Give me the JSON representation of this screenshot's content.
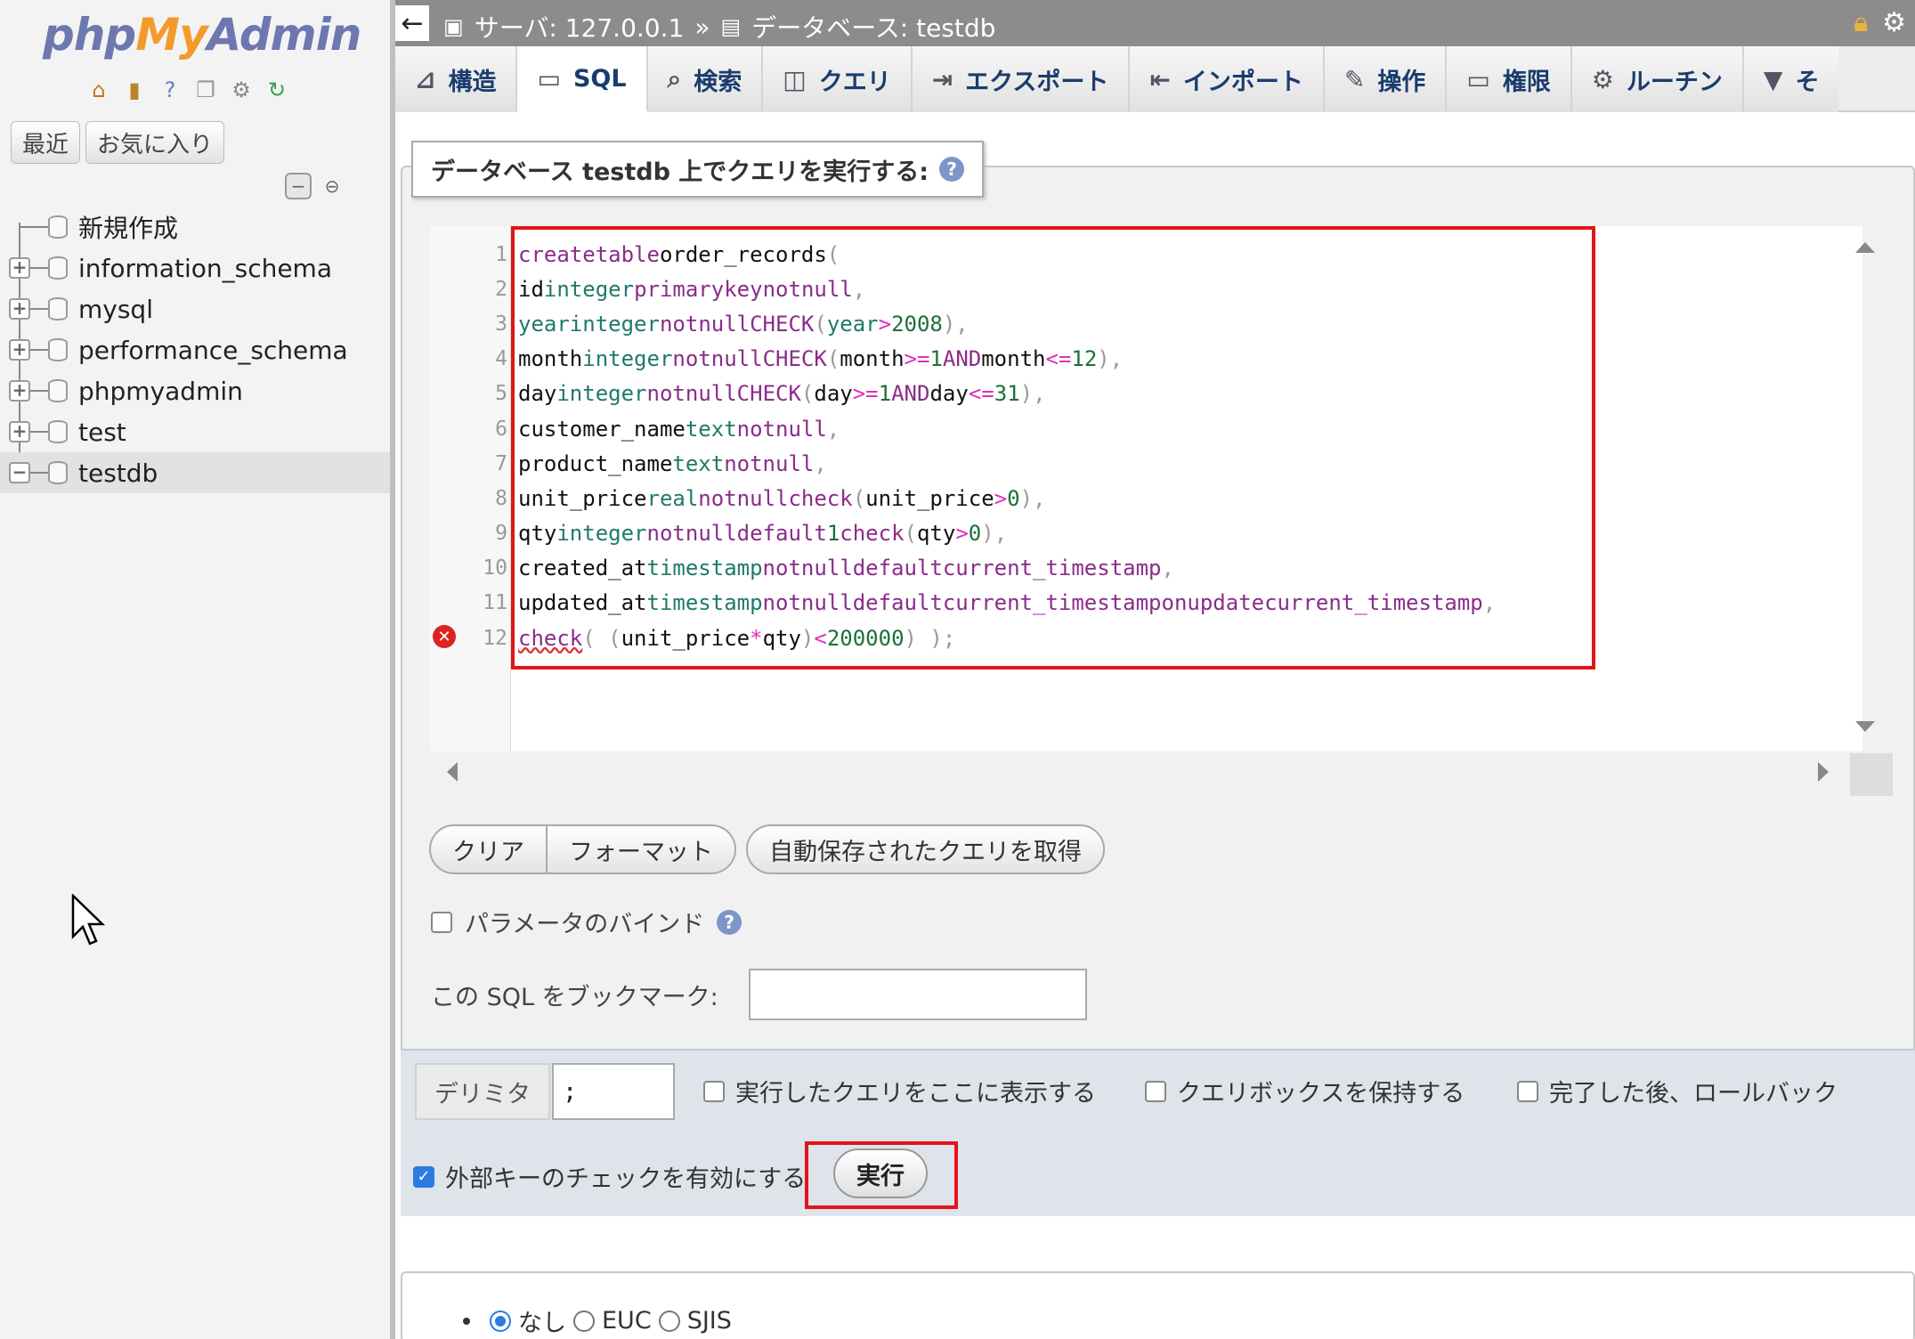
{
  "brand": {
    "part1": "php",
    "part2": "My",
    "part3": "Admin"
  },
  "nav": {
    "recent": "最近",
    "favorites": "お気に入り",
    "tree": [
      {
        "label": "新規作成",
        "expander": ""
      },
      {
        "label": "information_schema",
        "expander": "+"
      },
      {
        "label": "mysql",
        "expander": "+"
      },
      {
        "label": "performance_schema",
        "expander": "+"
      },
      {
        "label": "phpmyadmin",
        "expander": "+"
      },
      {
        "label": "test",
        "expander": "+"
      },
      {
        "label": "testdb",
        "expander": "−"
      }
    ]
  },
  "topbar": {
    "server": "サーバ: 127.0.0.1",
    "sep": "»",
    "database": "データベース: testdb"
  },
  "tabs": [
    {
      "label": "構造",
      "icon": "structure-icon"
    },
    {
      "label": "SQL",
      "icon": "sql-icon"
    },
    {
      "label": "検索",
      "icon": "search-icon"
    },
    {
      "label": "クエリ",
      "icon": "query-icon"
    },
    {
      "label": "エクスポート",
      "icon": "export-icon"
    },
    {
      "label": "インポート",
      "icon": "import-icon"
    },
    {
      "label": "操作",
      "icon": "wrench-icon"
    },
    {
      "label": "権限",
      "icon": "privileges-icon"
    },
    {
      "label": "ルーチン",
      "icon": "routines-icon"
    },
    {
      "label": "そ",
      "icon": "more-icon"
    }
  ],
  "legend": "データベース testdb 上でクエリを実行する:",
  "editor": {
    "line_numbers": [
      "1",
      "2",
      "3",
      "4",
      "5",
      "6",
      "7",
      "8",
      "9",
      "10",
      "11",
      "12"
    ]
  },
  "buttons": {
    "clear": "クリア",
    "format": "フォーマット",
    "autosaved": "自動保存されたクエリを取得",
    "go": "実行"
  },
  "bind_params": "パラメータのバインド",
  "bookmark_label": "この SQL をブックマーク:",
  "options": {
    "delimiter_label": "デリミタ",
    "delimiter_value": ";",
    "show_query": "実行したクエリをここに表示する",
    "retain_box": "クエリボックスを保持する",
    "rollback": "完了した後、ロールバック",
    "fk_checks": "外部キーのチェックを有効にする"
  },
  "charset": {
    "none": "なし",
    "euc": "EUC",
    "sjis": "SJIS"
  },
  "colors": {
    "highlight_red": "#e0151b",
    "tab_text": "#1a3c6d",
    "checkbox_blue": "#2a7be4"
  }
}
